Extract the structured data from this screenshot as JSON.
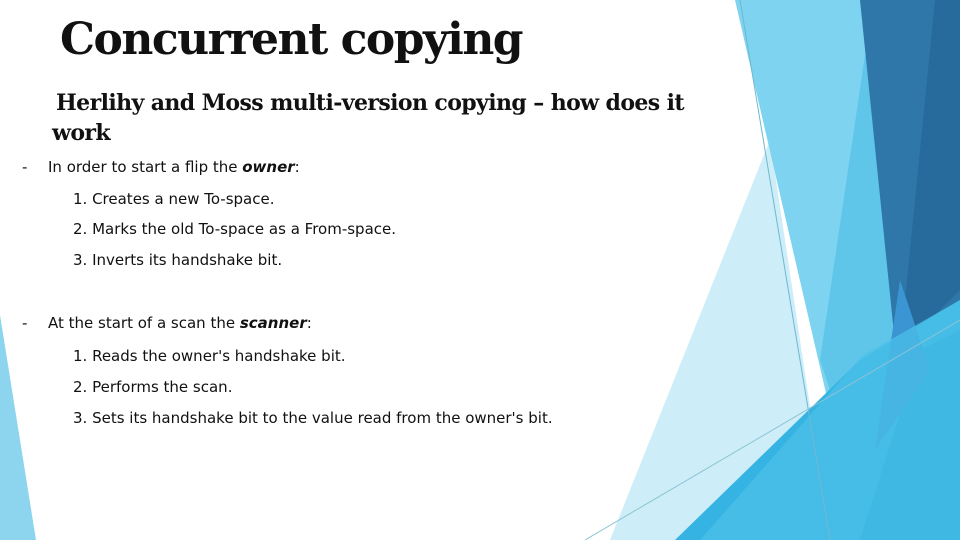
{
  "slide": {
    "title": "Concurrent copying",
    "subtitle": "Herlihy and Moss multi-version copying – how does it work",
    "sections": [
      {
        "dash": "-",
        "lead_text": "In order to start a flip the ",
        "emphasis": "owner",
        "trail": ":",
        "steps": [
          "1. Creates a new To-space.",
          "2. Marks the old To-space as a From-space.",
          "3. Inverts its handshake bit."
        ]
      },
      {
        "dash": "-",
        "lead_text": "At the start of a scan the ",
        "emphasis": "scanner",
        "trail": ":",
        "steps": [
          "1. Reads the owner's handshake bit.",
          "2. Performs the scan.",
          "3. Sets its handshake bit to the value read from the owner's bit."
        ]
      }
    ]
  },
  "theme": {
    "accent_dark": "#2e6fa0",
    "accent_darker": "#27679a",
    "accent_mid": "#28a8de",
    "accent_light": "#7dd3f0",
    "accent_pale": "#c8ebf8"
  }
}
